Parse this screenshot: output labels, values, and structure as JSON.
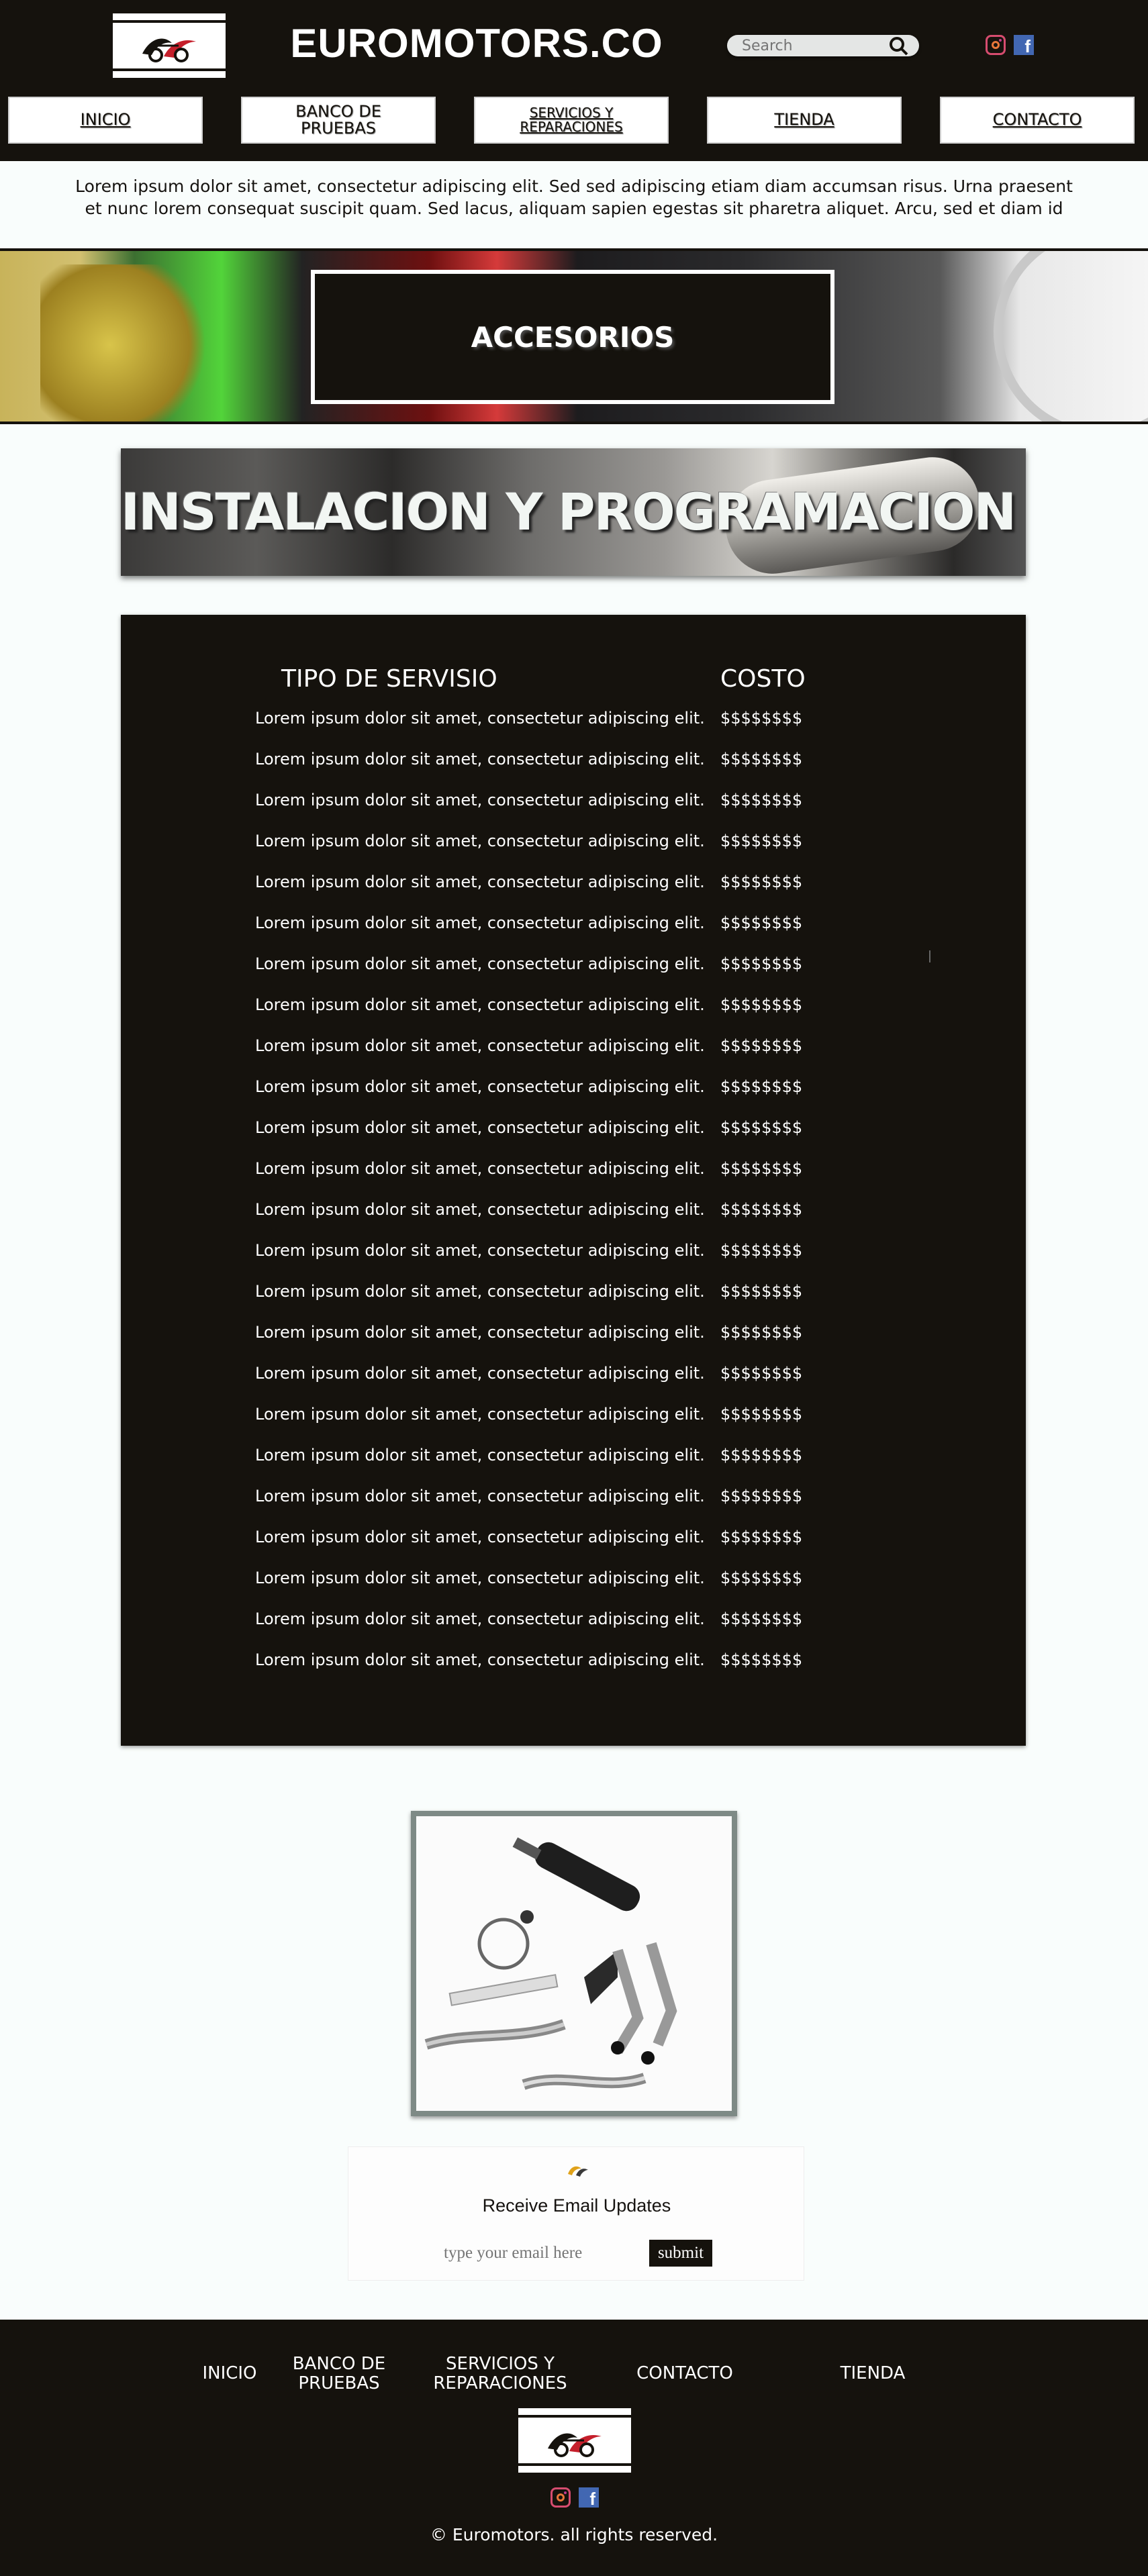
{
  "header": {
    "title": "EUROMOTORS.CO",
    "search_placeholder": "Search",
    "nav": [
      {
        "label": "INICIO"
      },
      {
        "label": "BANCO DE\nPRUEBAS"
      },
      {
        "label": "SERVICIOS Y\nREPARACIONES"
      },
      {
        "label": "TIENDA"
      },
      {
        "label": "CONTACTO"
      }
    ]
  },
  "intro": {
    "text": "Lorem ipsum dolor sit amet, consectetur adipiscing elit. Sed sed adipiscing etiam diam accumsan risus. Urna praesent et nunc lorem consequat suscipit quam. Sed lacus, aliquam sapien egestas sit pharetra aliquet. Arcu, sed et diam id"
  },
  "banner": {
    "title": "ACCESORIOS"
  },
  "install": {
    "title": "INSTALACION Y PROGRAMACION"
  },
  "table": {
    "col_service": "TIPO DE SERVISIO",
    "col_cost": "COSTO",
    "rows": [
      {
        "service": "Lorem ipsum dolor sit amet, consectetur adipiscing elit.",
        "cost": "$$$$$$$$"
      },
      {
        "service": "Lorem ipsum dolor sit amet, consectetur adipiscing elit.",
        "cost": "$$$$$$$$"
      },
      {
        "service": "Lorem ipsum dolor sit amet, consectetur adipiscing elit.",
        "cost": "$$$$$$$$"
      },
      {
        "service": "Lorem ipsum dolor sit amet, consectetur adipiscing elit.",
        "cost": "$$$$$$$$"
      },
      {
        "service": "Lorem ipsum dolor sit amet, consectetur adipiscing elit.",
        "cost": "$$$$$$$$"
      },
      {
        "service": "Lorem ipsum dolor sit amet, consectetur adipiscing elit.",
        "cost": "$$$$$$$$"
      },
      {
        "service": "Lorem ipsum dolor sit amet, consectetur adipiscing elit.",
        "cost": "$$$$$$$$"
      },
      {
        "service": "Lorem ipsum dolor sit amet, consectetur adipiscing elit.",
        "cost": "$$$$$$$$"
      },
      {
        "service": "Lorem ipsum dolor sit amet, consectetur adipiscing elit.",
        "cost": "$$$$$$$$"
      },
      {
        "service": "Lorem ipsum dolor sit amet, consectetur adipiscing elit.",
        "cost": "$$$$$$$$"
      },
      {
        "service": "Lorem ipsum dolor sit amet, consectetur adipiscing elit.",
        "cost": "$$$$$$$$"
      },
      {
        "service": "Lorem ipsum dolor sit amet, consectetur adipiscing elit.",
        "cost": "$$$$$$$$"
      },
      {
        "service": "Lorem ipsum dolor sit amet, consectetur adipiscing elit.",
        "cost": "$$$$$$$$"
      },
      {
        "service": "Lorem ipsum dolor sit amet, consectetur adipiscing elit.",
        "cost": "$$$$$$$$"
      },
      {
        "service": "Lorem ipsum dolor sit amet, consectetur adipiscing elit.",
        "cost": "$$$$$$$$"
      },
      {
        "service": "Lorem ipsum dolor sit amet, consectetur adipiscing elit.",
        "cost": "$$$$$$$$"
      },
      {
        "service": "Lorem ipsum dolor sit amet, consectetur adipiscing elit.",
        "cost": "$$$$$$$$"
      },
      {
        "service": "Lorem ipsum dolor sit amet, consectetur adipiscing elit.",
        "cost": "$$$$$$$$"
      },
      {
        "service": "Lorem ipsum dolor sit amet, consectetur adipiscing elit.",
        "cost": "$$$$$$$$"
      },
      {
        "service": "Lorem ipsum dolor sit amet, consectetur adipiscing elit.",
        "cost": "$$$$$$$$"
      },
      {
        "service": "Lorem ipsum dolor sit amet, consectetur adipiscing elit.",
        "cost": "$$$$$$$$"
      },
      {
        "service": "Lorem ipsum dolor sit amet, consectetur adipiscing elit.",
        "cost": "$$$$$$$$"
      },
      {
        "service": "Lorem ipsum dolor sit amet, consectetur adipiscing elit.",
        "cost": "$$$$$$$$"
      },
      {
        "service": "Lorem ipsum dolor sit amet, consectetur adipiscing elit.",
        "cost": "$$$$$$$$"
      }
    ]
  },
  "newsletter": {
    "title": "Receive Email Updates",
    "placeholder": "type your email here",
    "submit_label": "submit"
  },
  "footer": {
    "links": [
      {
        "label": "INICIO"
      },
      {
        "label": "BANCO DE\nPRUEBAS"
      },
      {
        "label": "SERVICIOS Y\nREPARACIONES"
      },
      {
        "label": "CONTACTO"
      },
      {
        "label": "TIENDA"
      }
    ],
    "copyright": "© Euromotors. all rights reserved."
  },
  "icons": {
    "instagram": "instagram-icon",
    "facebook": "facebook-icon",
    "search": "search-icon",
    "logo": "motorcycle-logo"
  },
  "colors": {
    "dark": "#15120d",
    "background": "#f9fdfc",
    "facebook": "#4267b2",
    "instagram": "#d64c6f"
  }
}
